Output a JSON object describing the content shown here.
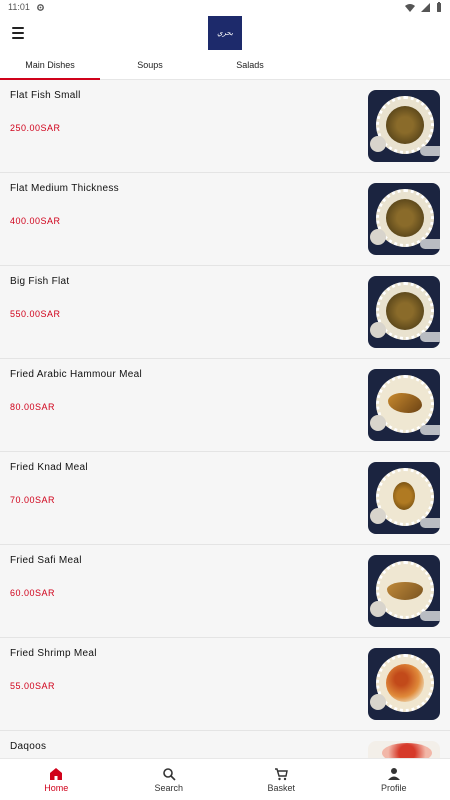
{
  "status_bar": {
    "time": "11:01"
  },
  "header": {
    "logo_text": "بحري"
  },
  "tabs": [
    {
      "label": "Main Dishes",
      "active": true
    },
    {
      "label": "Soups",
      "active": false
    },
    {
      "label": "Salads",
      "active": false
    }
  ],
  "colors": {
    "accent": "#d0021b",
    "logo_bg": "#1d2a6b"
  },
  "items": [
    {
      "name": "Flat Fish Small",
      "price": "250.00SAR",
      "thumb": "fish-platter"
    },
    {
      "name": "Flat Medium Thickness",
      "price": "400.00SAR",
      "thumb": "fish-platter"
    },
    {
      "name": "Big Fish Flat",
      "price": "550.00SAR",
      "thumb": "fish-platter"
    },
    {
      "name": "Fried Arabic Hammour Meal",
      "price": "80.00SAR",
      "thumb": "fried-fish-rice"
    },
    {
      "name": "Fried Knad Meal",
      "price": "70.00SAR",
      "thumb": "fried-fish-rice"
    },
    {
      "name": "Fried Safi Meal",
      "price": "60.00SAR",
      "thumb": "fried-fish-rice"
    },
    {
      "name": "Fried Shrimp Meal",
      "price": "55.00SAR",
      "thumb": "shrimp-rice"
    },
    {
      "name": "Daqoos",
      "price": "",
      "thumb": "daqoos-sauce"
    }
  ],
  "bottom_nav": [
    {
      "label": "Home",
      "icon": "home-icon",
      "active": true
    },
    {
      "label": "Search",
      "icon": "search-icon",
      "active": false
    },
    {
      "label": "Basket",
      "icon": "basket-icon",
      "active": false
    },
    {
      "label": "Profile",
      "icon": "profile-icon",
      "active": false
    }
  ]
}
